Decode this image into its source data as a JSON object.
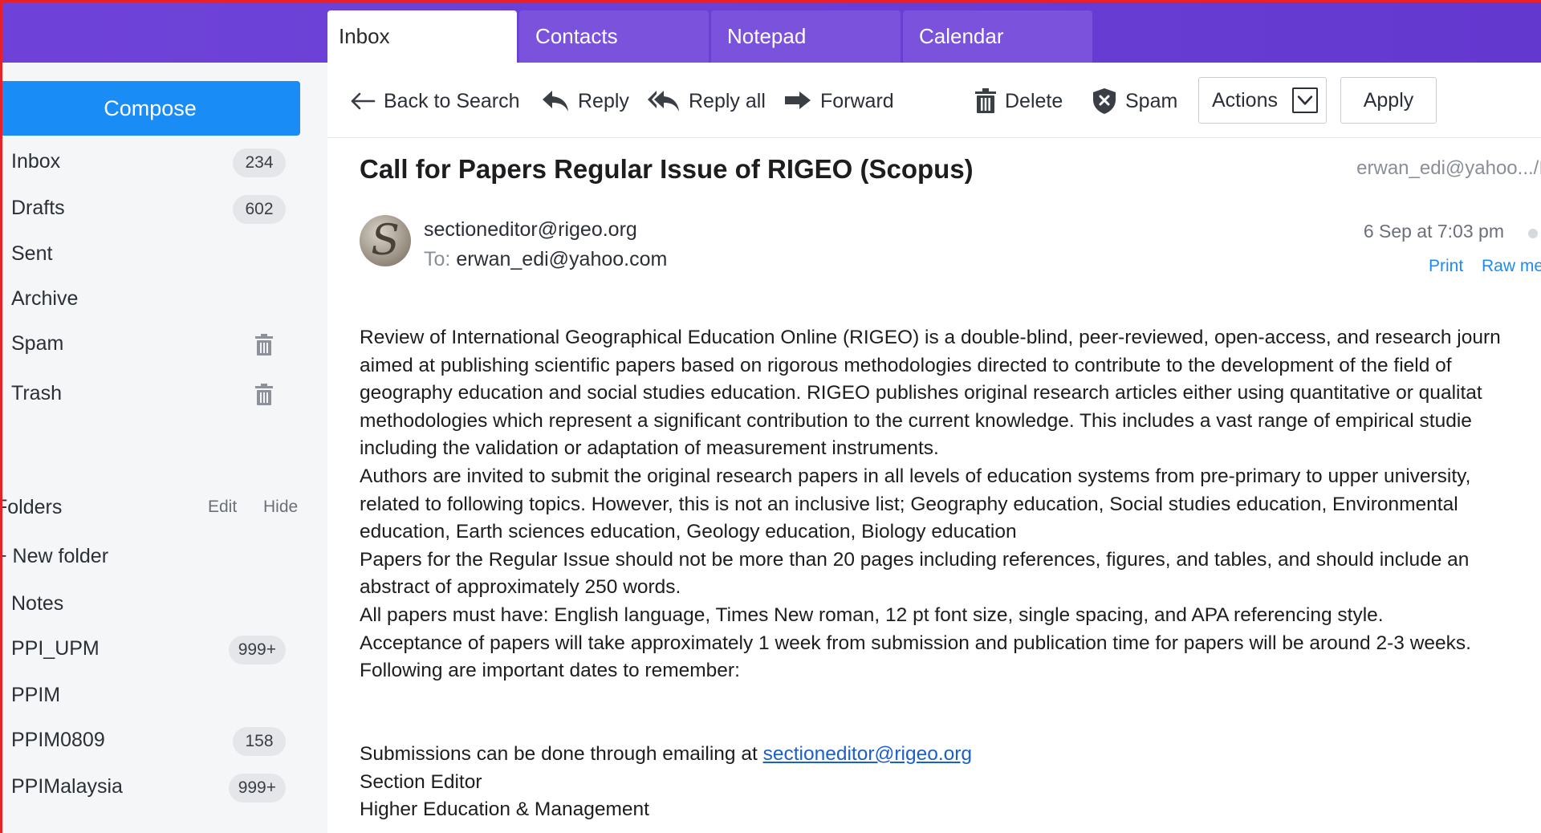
{
  "tabs": [
    "Inbox",
    "Contacts",
    "Notepad",
    "Calendar"
  ],
  "sidebar": {
    "compose": "Compose",
    "items": [
      {
        "label": "Inbox",
        "count": "234"
      },
      {
        "label": "Drafts",
        "count": "602"
      },
      {
        "label": "Sent",
        "count": ""
      },
      {
        "label": "Archive",
        "count": ""
      },
      {
        "label": "Spam",
        "icon": "trash-icon"
      },
      {
        "label": "Trash",
        "icon": "trash-icon"
      }
    ],
    "folders_title": "Folders",
    "folders_edit": "Edit",
    "folders_hide": "Hide",
    "new_folder": "+ New folder",
    "folders": [
      {
        "label": "Notes",
        "count": ""
      },
      {
        "label": "PPI_UPM",
        "count": "999+"
      },
      {
        "label": "PPIM",
        "count": ""
      },
      {
        "label": "PPIM0809",
        "count": "158"
      },
      {
        "label": "PPIMalaysia",
        "count": "999+"
      }
    ]
  },
  "toolbar": {
    "back": "Back to Search",
    "reply": "Reply",
    "reply_all": "Reply all",
    "forward": "Forward",
    "delete": "Delete",
    "spam": "Spam",
    "actions": "Actions",
    "apply": "Apply"
  },
  "message": {
    "subject": "Call for Papers Regular Issue of RIGEO (Scopus)",
    "account": "erwan_edi@yahoo.../I",
    "sender": "sectioneditor@rigeo.org",
    "to_label": "To:",
    "to": "erwan_edi@yahoo.com",
    "date": "6 Sep at 7:03 pm",
    "print": "Print",
    "raw": "Raw me",
    "body_lines": [
      "Review of International Geographical Education Online (RIGEO) is a double-blind, peer-reviewed, open-access, and research journ",
      "aimed at publishing scientific papers based on rigorous methodologies directed to contribute to the development of the field of",
      "geography education and social studies education. RIGEO publishes original research articles either using quantitative or qualitat",
      "methodologies which represent a significant contribution to the current knowledge. This includes a vast range of empirical studie",
      "including the validation or adaptation of measurement instruments.",
      "Authors are invited to submit the original research papers in all levels of education systems from pre-primary to upper university,",
      "related to following topics. However, this is not an inclusive list; Geography education, Social studies education, Environmental",
      "education, Earth sciences education, Geology education, Biology education",
      "Papers for the Regular Issue should not be more than 20 pages including references, figures, and tables, and should include an",
      "abstract of approximately 250 words.",
      "All papers must have: English language, Times New roman, 12 pt font size, single spacing, and APA referencing style.",
      "Acceptance of papers will take approximately 1 week from submission and publication time for papers will be around 2-3 weeks.",
      "Following are important dates to remember:"
    ],
    "submissions_prefix": "Submissions can be done through emailing at ",
    "submissions_link": "sectioneditor@rigeo.org",
    "signature_1": "Section Editor",
    "signature_2": "Higher Education & Management"
  }
}
